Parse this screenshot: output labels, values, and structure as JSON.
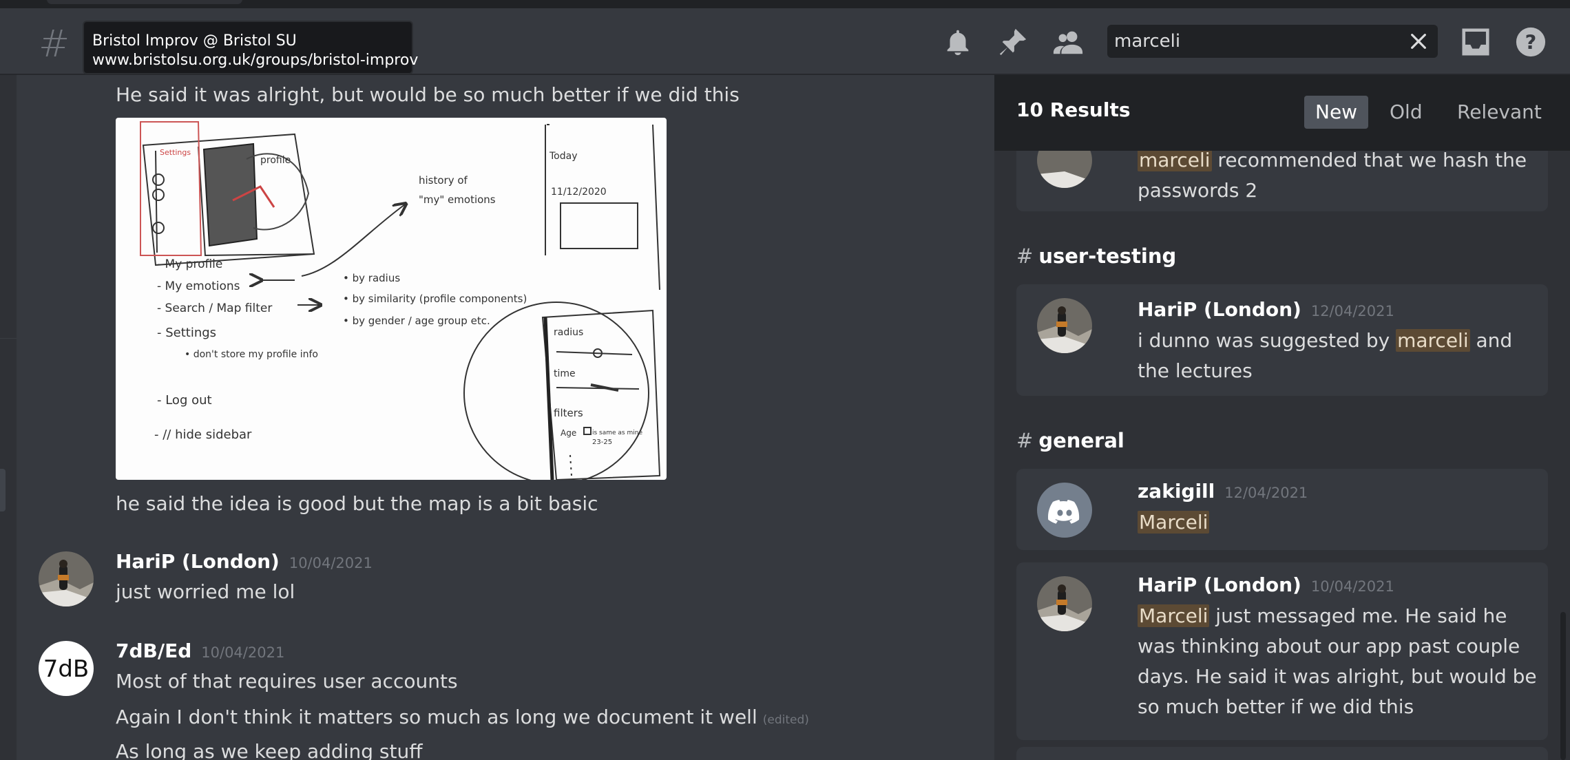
{
  "tooltip": {
    "title": "Bristol Improv @ Bristol SU",
    "url": "www.bristolsu.org.uk/groups/bristol-improv"
  },
  "header": {
    "icons": [
      "bell-icon",
      "pin-icon",
      "members-icon",
      "inbox-icon",
      "help-icon"
    ],
    "search_value": "marceli"
  },
  "chat": {
    "line_top": "He said it was alright, but would be so much better if we did this",
    "line_after_image": "he said the idea is good but the map is a bit basic",
    "messages": [
      {
        "author": "HariP (London)",
        "timestamp": "10/04/2021",
        "lines": [
          "just worried me lol"
        ]
      },
      {
        "author": "7dB/Ed",
        "timestamp": "10/04/2021",
        "avatar_text": "7dB",
        "lines": [
          "Most of that requires user accounts",
          "Again I don't think it matters so much as long we document it well",
          "As long as we keep adding stuff"
        ],
        "edited_label": "(edited)"
      }
    ]
  },
  "sketch": {
    "labels": {
      "profile": "profile",
      "history_of": "history of",
      "my_emotions": "\"my\" emotions",
      "today": "Today",
      "date": "11/12/2020",
      "my_profile": "- My profile",
      "my_emotions_item": "- My emotions",
      "search_map_filter": "- Search / Map filter",
      "settings": "- Settings",
      "dont_store": "• don't store my profile info",
      "log_out": "- Log out",
      "hide_sidebar": "- // hide sidebar",
      "by_radius": "• by radius",
      "by_similarity": "• by similarity (profile components)",
      "by_gender": "• by gender / age group etc.",
      "radius": "radius",
      "time": "time",
      "filters": "filters",
      "age": "Age",
      "same_as_mine": "is same as mine",
      "age_range": "23-25"
    }
  },
  "results": {
    "count_label": "10 Results",
    "sort_tabs": [
      "New",
      "Old",
      "Relevant"
    ],
    "active_sort": "New",
    "first_card": {
      "hl": "marceli",
      "rest_line1": " recommended that we hash the",
      "line2": "passwords 2"
    },
    "groups": [
      {
        "channel": "user-testing",
        "items": [
          {
            "author": "HariP (London)",
            "timestamp": "12/04/2021",
            "pre": "i dunno was suggested by ",
            "hl": "marceli",
            "post": " and the lectures"
          }
        ]
      },
      {
        "channel": "general",
        "items": [
          {
            "author": "zakigill",
            "timestamp": "12/04/2021",
            "pre": "",
            "hl": "Marceli",
            "post": ""
          },
          {
            "author": "HariP (London)",
            "timestamp": "10/04/2021",
            "pre": "",
            "hl": "Marceli",
            "post": " just messaged me. He said he was thinking about our app past couple days. He said it was alright, but would be so much better if we did this"
          }
        ]
      }
    ]
  },
  "colors": {
    "background": "#36393f",
    "panel": "#2f3136",
    "highlight": "#5c4a34",
    "discord_blurple": "#5865f2"
  }
}
